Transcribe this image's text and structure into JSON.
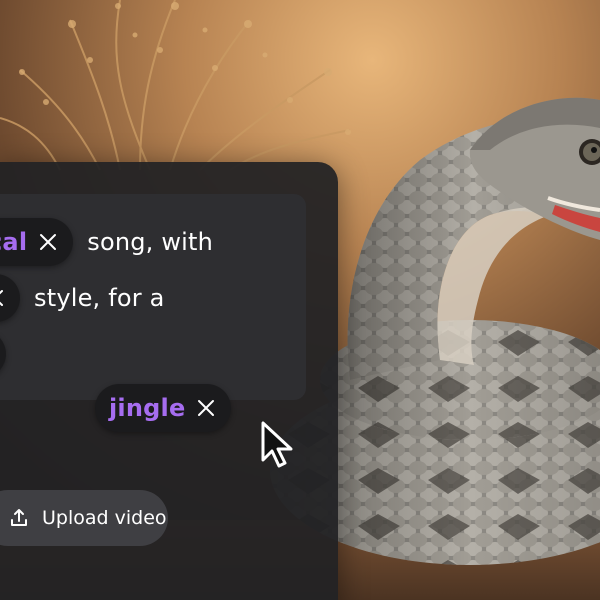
{
  "prompt": {
    "line1": {
      "chip": "cal",
      "text": "song, with"
    },
    "line2": {
      "chip": "",
      "text": "style, for a"
    },
    "line3": {
      "chip": ""
    },
    "line4": {
      "chip": "jingle"
    }
  },
  "upload": {
    "label": "Upload video"
  },
  "icons": {
    "remove": "close-icon",
    "upload": "upload-icon",
    "cursor": "mouse-pointer-icon"
  },
  "colors": {
    "accent": "#a66df0",
    "panel": "#222224",
    "chip": "#1b1b1d",
    "button": "#3f3f43"
  }
}
